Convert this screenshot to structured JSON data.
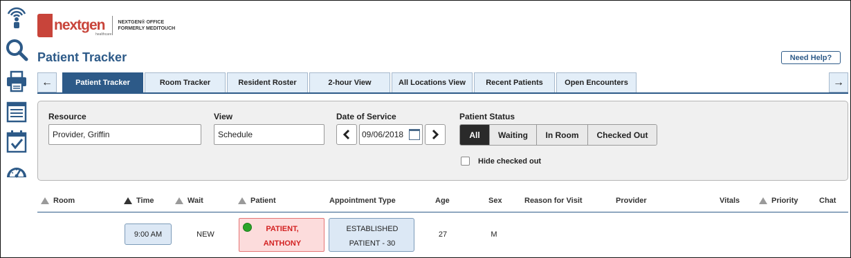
{
  "app": {
    "logo_text": "nextgen",
    "logo_small": "healthcare",
    "logo_sub_line1": "NEXTGEN® OFFICE",
    "logo_sub_line2": "FORMERLY MEDITOUCH",
    "page_title": "Patient Tracker",
    "help_label": "Need Help?"
  },
  "rail": [
    "signal-person-icon",
    "search-icon",
    "printer-icon",
    "list-icon",
    "checklist-icon",
    "dashboard-gauge-icon"
  ],
  "tabs": {
    "items": [
      "Patient Tracker",
      "Room Tracker",
      "Resident Roster",
      "2-hour View",
      "All Locations View",
      "Recent Patients",
      "Open Encounters"
    ],
    "active_index": 0
  },
  "filters": {
    "resource_label": "Resource",
    "resource_value": "Provider, Griffin",
    "view_label": "View",
    "view_value": "Schedule",
    "date_label": "Date of Service",
    "date_value": "09/06/2018",
    "status_label": "Patient Status",
    "status_options": [
      "All",
      "Waiting",
      "In Room",
      "Checked Out"
    ],
    "status_selected": "All",
    "hide_checked_out_label": "Hide checked out",
    "hide_checked_out": false
  },
  "table": {
    "columns": [
      "Room",
      "Time",
      "Wait",
      "Patient",
      "Appointment Type",
      "Age",
      "Sex",
      "Reason for Visit",
      "Provider",
      "Vitals",
      "Priority",
      "Chat"
    ],
    "rows": [
      {
        "room": "",
        "time": "9:00 AM",
        "wait": "NEW",
        "patient_line1": "PATIENT,",
        "patient_line2": "ANTHONY",
        "appt_line1": "ESTABLISHED",
        "appt_line2": "PATIENT - 30",
        "age": "27",
        "sex": "M",
        "reason": "",
        "provider": "",
        "vitals": "",
        "priority": "",
        "chat": ""
      }
    ]
  },
  "colors": {
    "brand_red": "#c8443a",
    "primary_blue": "#2d5a88",
    "tab_bg": "#e3eef8",
    "patient_red": "#d32222",
    "status_green": "#2aa52a"
  }
}
